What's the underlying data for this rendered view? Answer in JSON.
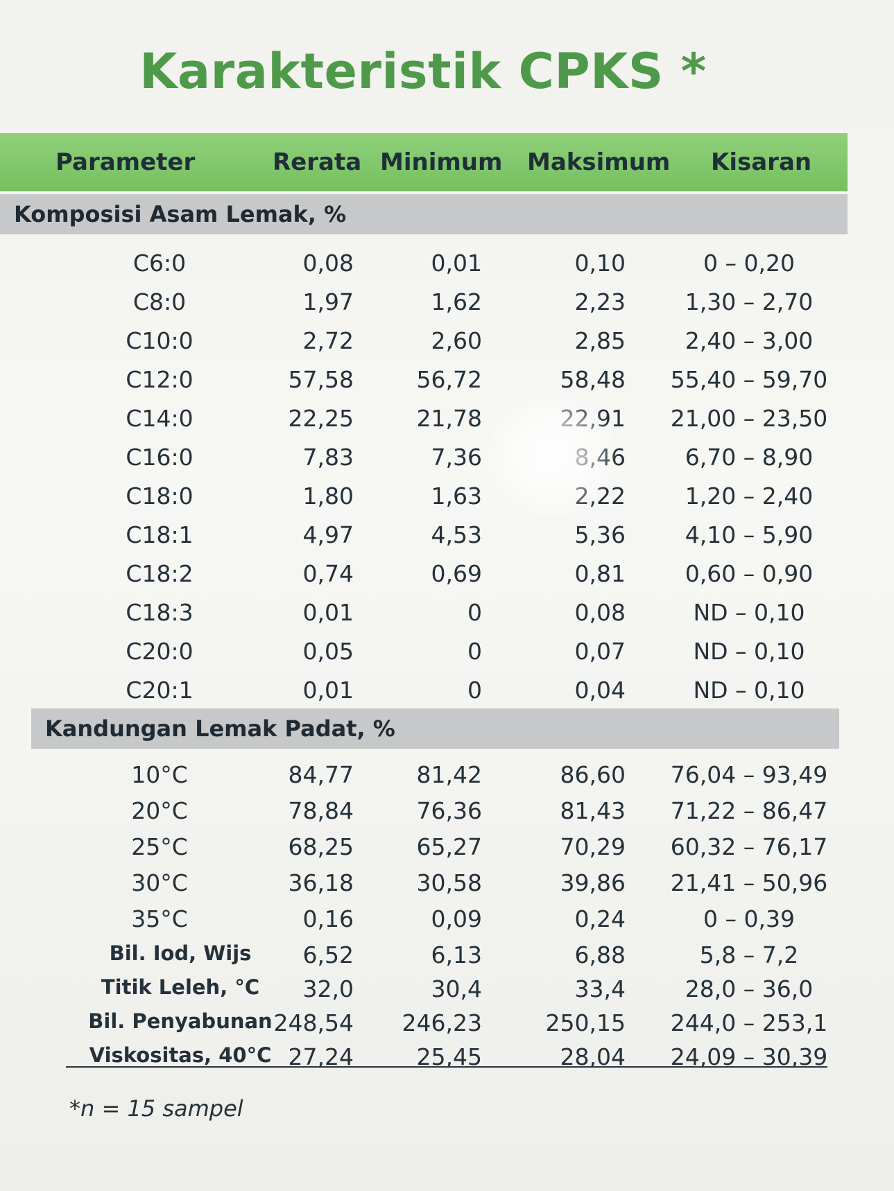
{
  "title": "Karakteristik CPKS *",
  "columns": [
    "Parameter",
    "Rerata",
    "Minimum",
    "Maksimum",
    "Kisaran"
  ],
  "sections": [
    {
      "label": "Komposisi Asam Lemak, %",
      "rows": [
        [
          "C6:0",
          "0,08",
          "0,01",
          "0,10",
          "0 – 0,20"
        ],
        [
          "C8:0",
          "1,97",
          "1,62",
          "2,23",
          "1,30 – 2,70"
        ],
        [
          "C10:0",
          "2,72",
          "2,60",
          "2,85",
          "2,40 – 3,00"
        ],
        [
          "C12:0",
          "57,58",
          "56,72",
          "58,48",
          "55,40 – 59,70"
        ],
        [
          "C14:0",
          "22,25",
          "21,78",
          "22,91",
          "21,00 – 23,50"
        ],
        [
          "C16:0",
          "7,83",
          "7,36",
          "8,46",
          "6,70 – 8,90"
        ],
        [
          "C18:0",
          "1,80",
          "1,63",
          "2,22",
          "1,20 – 2,40"
        ],
        [
          "C18:1",
          "4,97",
          "4,53",
          "5,36",
          "4,10 – 5,90"
        ],
        [
          "C18:2",
          "0,74",
          "0,69",
          "0,81",
          "0,60 – 0,90"
        ],
        [
          "C18:3",
          "0,01",
          "0",
          "0,08",
          "ND – 0,10"
        ],
        [
          "C20:0",
          "0,05",
          "0",
          "0,07",
          "ND – 0,10"
        ],
        [
          "C20:1",
          "0,01",
          "0",
          "0,04",
          "ND – 0,10"
        ]
      ]
    },
    {
      "label": "Kandungan Lemak Padat, %",
      "rows": [
        [
          "10°C",
          "84,77",
          "81,42",
          "86,60",
          "76,04 – 93,49"
        ],
        [
          "20°C",
          "78,84",
          "76,36",
          "81,43",
          "71,22 – 86,47"
        ],
        [
          "25°C",
          "68,25",
          "65,27",
          "70,29",
          "60,32 – 76,17"
        ],
        [
          "30°C",
          "36,18",
          "30,58",
          "39,86",
          "21,41 – 50,96"
        ],
        [
          "35°C",
          "0,16",
          "0,09",
          "0,24",
          "0 – 0,39"
        ]
      ]
    }
  ],
  "extra_rows": [
    [
      "Bil. Iod, Wijs",
      "6,52",
      "6,13",
      "6,88",
      "5,8 – 7,2"
    ],
    [
      "Titik Leleh, °C",
      "32,0",
      "30,4",
      "33,4",
      "28,0 – 36,0"
    ],
    [
      "Bil. Penyabunan",
      "248,54",
      "246,23",
      "250,15",
      "244,0 – 253,1"
    ],
    [
      "Viskositas, 40°C",
      "27,24",
      "25,45",
      "28,04",
      "24,09 – 30,39"
    ]
  ],
  "footnote": "*n = 15 sampel"
}
